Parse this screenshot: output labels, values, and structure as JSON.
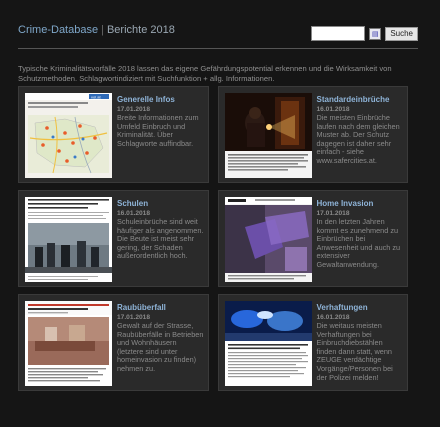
{
  "header": {
    "app_name": "Crime-Database",
    "separator": "|",
    "page_title": "Berichte 2018"
  },
  "search": {
    "input_value": "",
    "button_label": "Suche"
  },
  "intro": "Typische Kriminalitätsvorfälle 2018 lassen das eigene Gefährdungspotential erkennen und die Wirksamkeit von Schutzmethoden. Schlagwortindiziert mit Suchfunktion + allg. Informationen.",
  "cards": [
    {
      "title": "Generelle Infos",
      "date": "17.01.2018",
      "description": "Breite Informationen zum Umfeld Einbruch und Kriminalität. Über Schlagworte auffindbar."
    },
    {
      "title": "Standardeinbrüche",
      "date": "16.01.2018",
      "description": "Die meisten Einbrüche laufen nach dem gleichen Muster ab. Der Schutz dagegen ist daher sehr einfach - siehe www.safercities.at."
    },
    {
      "title": "Schulen",
      "date": "16.01.2018",
      "description": "Schuleinbrüche sind weit häufiger als angenommen. Die Beute ist meist sehr gering, der Schaden außerordentlich hoch."
    },
    {
      "title": "Home Invasion",
      "date": "17.01.2018",
      "description": "In den letzten Jahren kommt es zunehmend zu Einbrüchen bei Anwesenheit und auch zu extensiver Gewaltanwendung."
    },
    {
      "title": "Raubüberfall",
      "date": "17.01.2018",
      "description": "Gewalt auf der Strasse, Raubüberfälle in Betrieben und Wohnhäusern (letztere sind unter homeinvasion zu finden) nehmen zu."
    },
    {
      "title": "Verhaftungen",
      "date": "16.01.2018",
      "description": "Die weitaus meisten Verhaftungen bei Einbruchdiebstählen finden dann statt, wenn ZEUGE verdächtige Vorgänge/Personen bei der Polizei melden!"
    }
  ],
  "thumb_texts": {
    "schulen_headline": "Unbekannte randalierten in Klosterneuburger Schule und legten mehrmals Feuer",
    "raub_headline": "Polizei fahndet nach: 07. Uhr gegen Juwelier: Überfall Betroffener",
    "verhaft_label": "Home Invasion",
    "generelle_logo": "vol.at"
  }
}
